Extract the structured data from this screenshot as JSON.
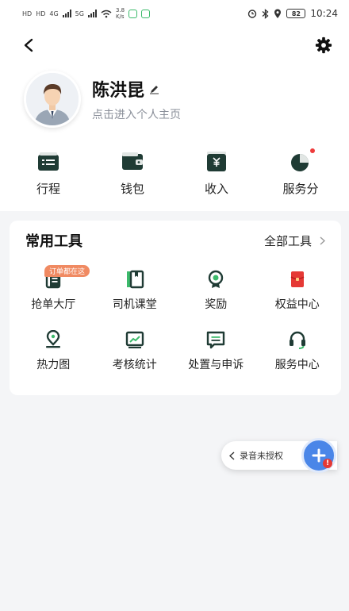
{
  "status_bar": {
    "left_labels": [
      "HD",
      "HD",
      "4G",
      "5G"
    ],
    "net_speed_value": "3.8",
    "net_speed_unit": "K/s",
    "time": "10:24",
    "battery": "82",
    "icons": [
      "alarm-icon",
      "bluetooth-icon",
      "location-icon"
    ]
  },
  "nav": {
    "back_icon": "back-chevron-icon",
    "settings_icon": "gear-icon"
  },
  "profile": {
    "name": "陈洪昆",
    "subtitle": "点击进入个人主页",
    "edit_icon": "pencil-icon"
  },
  "quick_actions": [
    {
      "label": "行程",
      "icon": "itinerary-icon"
    },
    {
      "label": "钱包",
      "icon": "wallet-icon"
    },
    {
      "label": "收入",
      "icon": "income-icon"
    },
    {
      "label": "服务分",
      "icon": "service-score-icon",
      "has_dot": true
    }
  ],
  "tools": {
    "title": "常用工具",
    "all_label": "全部工具",
    "tag": "订单都在这",
    "items": [
      {
        "label": "抢单大厅",
        "icon": "order-hall-icon"
      },
      {
        "label": "司机课堂",
        "icon": "driver-class-icon"
      },
      {
        "label": "奖励",
        "icon": "reward-icon"
      },
      {
        "label": "权益中心",
        "icon": "benefits-icon"
      },
      {
        "label": "热力图",
        "icon": "heatmap-icon"
      },
      {
        "label": "考核统计",
        "icon": "stats-icon"
      },
      {
        "label": "处置与申诉",
        "icon": "appeal-icon"
      },
      {
        "label": "服务中心",
        "icon": "headset-icon"
      }
    ]
  },
  "recording": {
    "label": "录音未授权",
    "badge": "!"
  },
  "colors": {
    "accent_green": "#1f3b34",
    "tag_orange": "#f08a62",
    "alert_red": "#e53935",
    "badge_blue": "#4a86e8"
  }
}
